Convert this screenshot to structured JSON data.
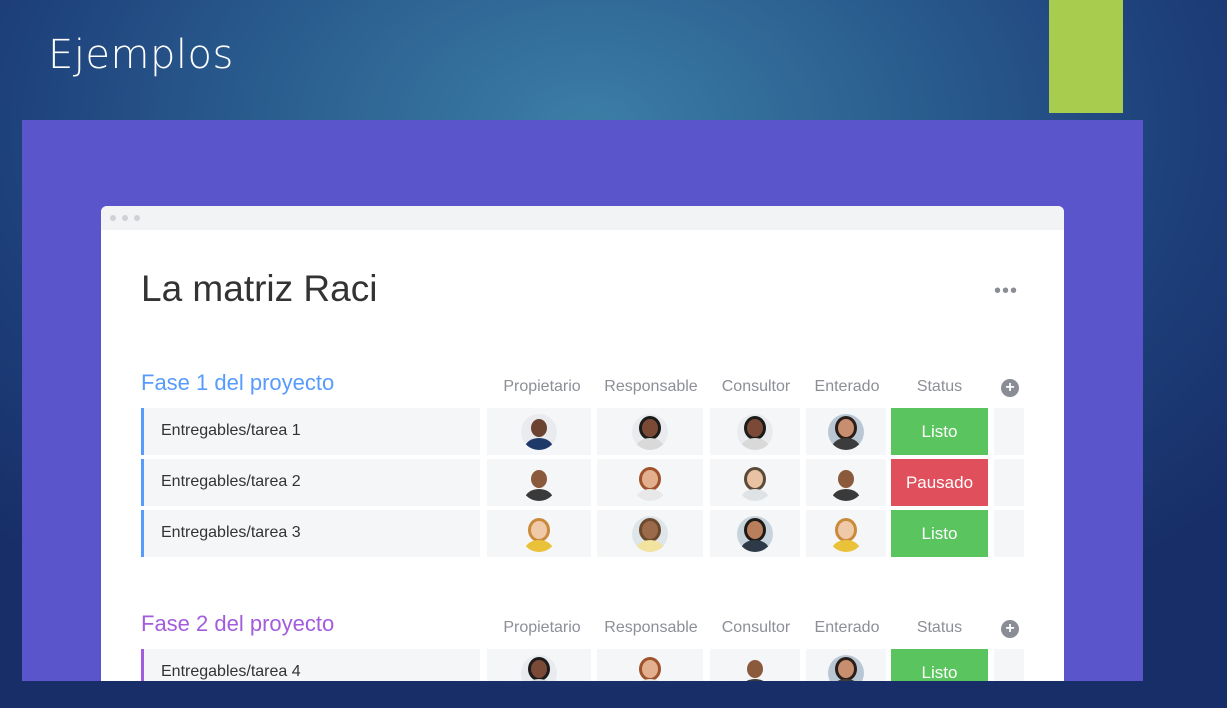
{
  "slide": {
    "title": "Ejemplos"
  },
  "window": {
    "title": "La matriz Raci",
    "menu_label": "•••"
  },
  "columns": [
    "Propietario",
    "Responsable",
    "Consultor",
    "Enterado",
    "Status"
  ],
  "add_column_label": "+",
  "groups": [
    {
      "title": "Fase 1 del proyecto",
      "color": "#579bfc",
      "rows": [
        {
          "name": "Entregables/tarea 1",
          "status": "Listo"
        },
        {
          "name": "Entregables/tarea 2",
          "status": "Pausado"
        },
        {
          "name": "Entregables/tarea 3",
          "status": "Listo"
        }
      ]
    },
    {
      "title": "Fase 2 del proyecto",
      "color": "#a25ddc",
      "rows": [
        {
          "name": "Entregables/tarea 4",
          "status": "Listo"
        }
      ]
    }
  ],
  "colors": {
    "accent_green_block": "#a7cc4e",
    "panel_purple": "#5b55cb",
    "status_done": "#5ac55e",
    "status_stuck": "#df4f5c"
  }
}
